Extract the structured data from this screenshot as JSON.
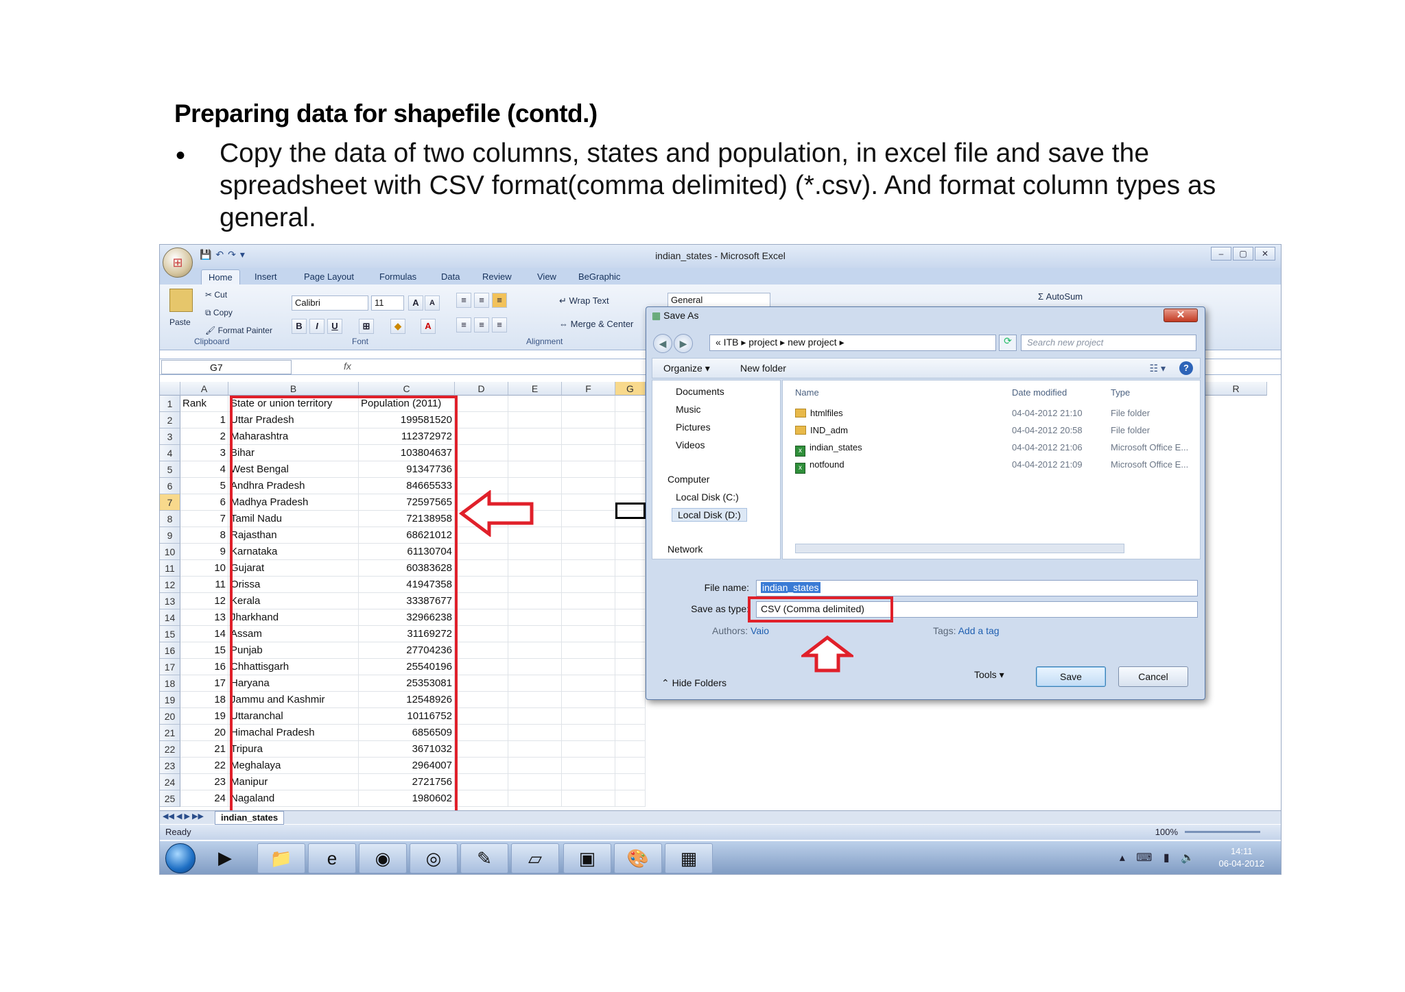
{
  "slide": {
    "heading": "Preparing data for shapefile (contd.)",
    "bullet_marker": "•",
    "bullet_text": "Copy the data of two columns, states and population, in excel file  and save the spreadsheet with CSV format(comma delimited) (*.csv). And format column types as general."
  },
  "excel": {
    "window_title": "indian_states - Microsoft Excel",
    "window_controls": [
      "–",
      "▢",
      "✕"
    ],
    "tabs": [
      "Home",
      "Insert",
      "Page Layout",
      "Formulas",
      "Data",
      "Review",
      "View",
      "BeGraphic"
    ],
    "active_tab": "Home",
    "ribbon": {
      "paste": "Paste",
      "cut": "Cut",
      "copy": "Copy",
      "format_painter": "Format Painter",
      "clipboard": "Clipboard",
      "font_name": "Calibri",
      "font_size": "11",
      "bold": "B",
      "italic": "I",
      "underline": "U",
      "font": "Font",
      "wrap_text": "Wrap Text",
      "merge_center": "Merge & Center",
      "alignment": "Alignment",
      "number_format": "General",
      "autosum": "AutoSum"
    },
    "name_box": "G7",
    "fx": "fx",
    "columns": [
      "A",
      "B",
      "C",
      "D",
      "E",
      "F",
      "G",
      "R"
    ],
    "header_row": {
      "a": "Rank",
      "b": "State or union territory",
      "c": "Population (2011)"
    },
    "rows": [
      {
        "rank": "1",
        "state": "Uttar Pradesh",
        "pop": "199581520"
      },
      {
        "rank": "2",
        "state": "Maharashtra",
        "pop": "112372972"
      },
      {
        "rank": "3",
        "state": "Bihar",
        "pop": "103804637"
      },
      {
        "rank": "4",
        "state": "West Bengal",
        "pop": "91347736"
      },
      {
        "rank": "5",
        "state": "Andhra Pradesh",
        "pop": "84665533"
      },
      {
        "rank": "6",
        "state": "Madhya Pradesh",
        "pop": "72597565"
      },
      {
        "rank": "7",
        "state": "Tamil Nadu",
        "pop": "72138958"
      },
      {
        "rank": "8",
        "state": "Rajasthan",
        "pop": "68621012"
      },
      {
        "rank": "9",
        "state": "Karnataka",
        "pop": "61130704"
      },
      {
        "rank": "10",
        "state": "Gujarat",
        "pop": "60383628"
      },
      {
        "rank": "11",
        "state": "Orissa",
        "pop": "41947358"
      },
      {
        "rank": "12",
        "state": "Kerala",
        "pop": "33387677"
      },
      {
        "rank": "13",
        "state": "Jharkhand",
        "pop": "32966238"
      },
      {
        "rank": "14",
        "state": "Assam",
        "pop": "31169272"
      },
      {
        "rank": "15",
        "state": "Punjab",
        "pop": "27704236"
      },
      {
        "rank": "16",
        "state": "Chhattisgarh",
        "pop": "25540196"
      },
      {
        "rank": "17",
        "state": "Haryana",
        "pop": "25353081"
      },
      {
        "rank": "18",
        "state": "Jammu and Kashmir",
        "pop": "12548926"
      },
      {
        "rank": "19",
        "state": "Uttaranchal",
        "pop": "10116752"
      },
      {
        "rank": "20",
        "state": "Himachal Pradesh",
        "pop": "6856509"
      },
      {
        "rank": "21",
        "state": "Tripura",
        "pop": "3671032"
      },
      {
        "rank": "22",
        "state": "Meghalaya",
        "pop": "2964007"
      },
      {
        "rank": "23",
        "state": "Manipur",
        "pop": "2721756"
      },
      {
        "rank": "24",
        "state": "Nagaland",
        "pop": "1980602"
      }
    ],
    "row_numbers": [
      "1",
      "2",
      "3",
      "4",
      "5",
      "6",
      "7",
      "8",
      "9",
      "10",
      "11",
      "12",
      "13",
      "14",
      "15",
      "16",
      "17",
      "18",
      "19",
      "20",
      "21",
      "22",
      "23",
      "24",
      "25"
    ],
    "sheet_tab": "indian_states",
    "status": "Ready",
    "zoom": "100%",
    "clock_time": "14:11",
    "clock_date": "06-04-2012",
    "highlight_color": "#e0202a"
  },
  "dialog": {
    "title": "Save As",
    "breadcrumb": "«  ITB  ▸  project  ▸  new project  ▸",
    "search_placeholder": "Search new project",
    "organize": "Organize ▾",
    "new_folder": "New folder",
    "nav_items": [
      "Documents",
      "Music",
      "Pictures",
      "Videos",
      "Computer",
      "Local Disk (C:)",
      "Local Disk (D:)",
      "Network"
    ],
    "col_headers": [
      "Name",
      "Date modified",
      "Type"
    ],
    "files": [
      {
        "name": "htmlfiles",
        "date": "04-04-2012 21:10",
        "type": "File folder"
      },
      {
        "name": "IND_adm",
        "date": "04-04-2012 20:58",
        "type": "File folder"
      },
      {
        "name": "indian_states",
        "date": "04-04-2012 21:06",
        "type": "Microsoft Office E..."
      },
      {
        "name": "notfound",
        "date": "04-04-2012 21:09",
        "type": "Microsoft Office E..."
      }
    ],
    "file_name_label": "File name:",
    "file_name_value": "indian_states",
    "save_type_label": "Save as type:",
    "save_type_value": "CSV (Comma delimited)",
    "authors_label": "Authors:",
    "authors_value": "Vaio",
    "tags_label": "Tags:",
    "tags_value": "Add a tag",
    "hide_folders": "Hide Folders",
    "tools": "Tools",
    "save": "Save",
    "cancel": "Cancel"
  }
}
